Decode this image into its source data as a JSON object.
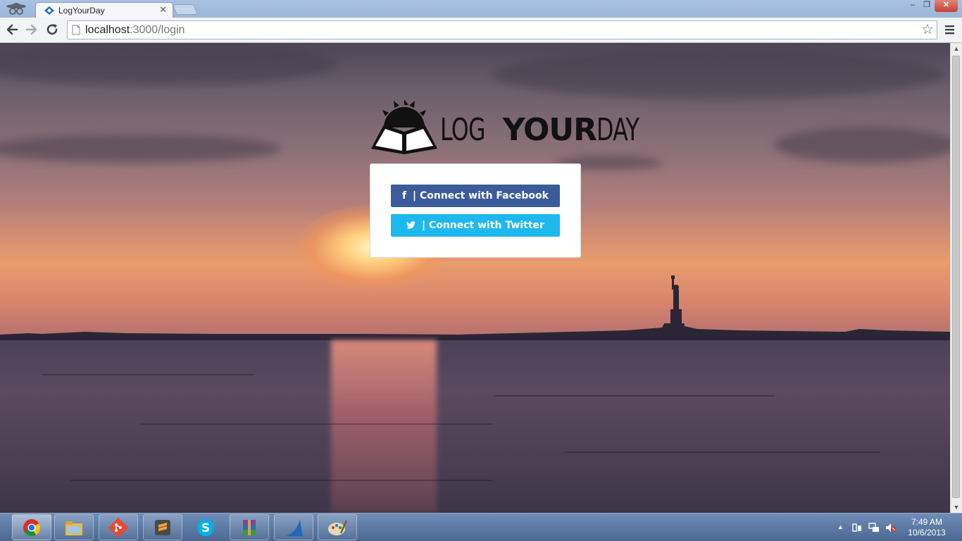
{
  "browser": {
    "tab_title": "LogYourDay",
    "tab_close": "✕",
    "url_host": "localhost",
    "url_path": ":3000/login",
    "window_controls": {
      "minimize": "–",
      "maximize": "❐",
      "close": "✕"
    }
  },
  "page": {
    "logo": {
      "part1": "LOG",
      "part2": "YOUR",
      "part3": "DAY"
    },
    "facebook_button": {
      "icon": "f",
      "label": " | Connect with Facebook"
    },
    "twitter_button": {
      "label": " | Connect with Twitter"
    }
  },
  "colors": {
    "facebook": "#3b5b9b",
    "twitter": "#1db8ee"
  },
  "taskbar": {
    "apps": [
      {
        "name": "chrome-icon"
      },
      {
        "name": "file-explorer-icon"
      },
      {
        "name": "git-icon"
      },
      {
        "name": "sublime-text-icon"
      },
      {
        "name": "skype-icon"
      },
      {
        "name": "winrar-icon"
      },
      {
        "name": "shark-app-icon"
      },
      {
        "name": "paint-icon"
      }
    ],
    "clock_time": "7:49 AM",
    "clock_date": "10/6/2013"
  }
}
